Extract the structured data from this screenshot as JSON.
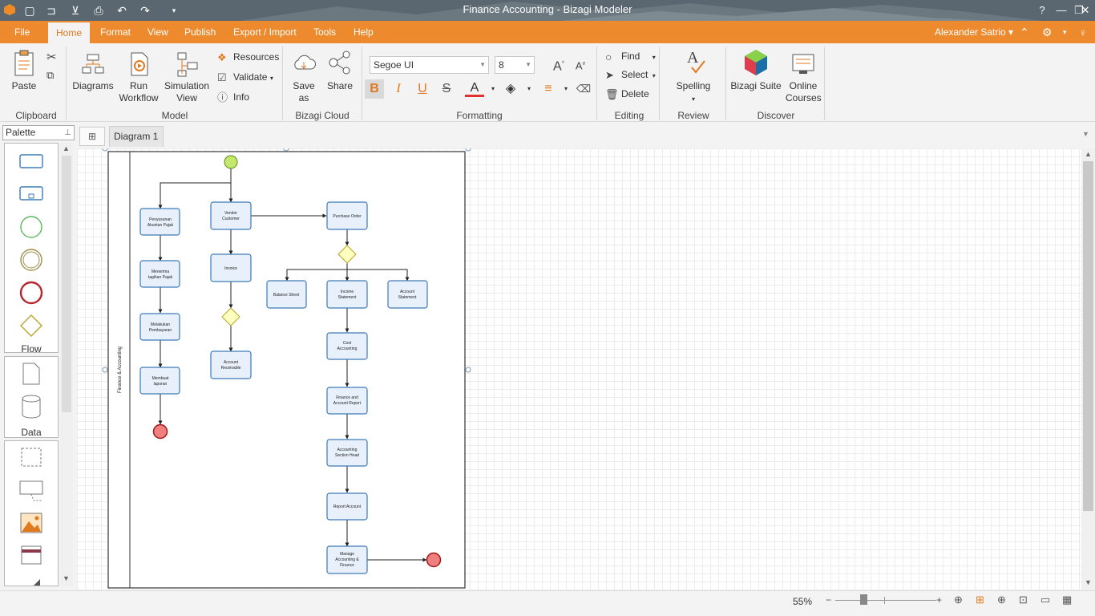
{
  "window": {
    "title": "Finance Accounting - Bizagi Modeler"
  },
  "menu": {
    "file": "File",
    "home": "Home",
    "format": "Format",
    "view": "View",
    "publish": "Publish",
    "export_import": "Export / Import",
    "tools": "Tools",
    "help": "Help",
    "user": "Alexander Satrio"
  },
  "ribbon": {
    "clipboard": {
      "paste": "Paste",
      "label": "Clipboard"
    },
    "model": {
      "diagrams": "Diagrams",
      "run_workflow_1": "Run",
      "run_workflow_2": "Workflow",
      "simulation_1": "Simulation",
      "simulation_2": "View",
      "resources": "Resources",
      "validate": "Validate",
      "info": "Info",
      "label": "Model"
    },
    "cloud": {
      "save_as": "Save as",
      "share": "Share",
      "label": "Bizagi Cloud"
    },
    "formatting": {
      "font": "Segoe UI",
      "size": "8",
      "label": "Formatting"
    },
    "editing": {
      "find": "Find",
      "select": "Select",
      "delete": "Delete",
      "label": "Editing"
    },
    "review": {
      "spelling": "Spelling",
      "label": "Review"
    },
    "discover": {
      "suite": "Bizagi Suite",
      "courses_1": "Online",
      "courses_2": "Courses",
      "label": "Discover"
    }
  },
  "palette": {
    "title": "Palette",
    "flow": "Flow",
    "data": "Data"
  },
  "tabs": {
    "diagram1": "Diagram 1"
  },
  "diagram": {
    "lane": "Finance & Accounting",
    "tasks": {
      "t1": [
        "Penyusunan",
        "Akuntan Pajak"
      ],
      "t2": [
        "Menerima",
        "tagihan Pajak"
      ],
      "t3": [
        "Melakukan",
        "Pembayaran"
      ],
      "t4": [
        "Membuat",
        "laporan"
      ],
      "t5": [
        "Vendor",
        "Customer"
      ],
      "t6": [
        "Invoice"
      ],
      "t7": [
        "Account",
        "Receivable"
      ],
      "t8": [
        "Purchase Order"
      ],
      "t9": [
        "Balance Sheet"
      ],
      "t10": [
        "Income",
        "Statement"
      ],
      "t11": [
        "Account",
        "Statement"
      ],
      "t12": [
        "Cost",
        "Accounting"
      ],
      "t13": [
        "Finance and",
        "Account Report"
      ],
      "t14": [
        "Accounting",
        "Section Head"
      ],
      "t15": [
        "Report Account"
      ],
      "t16": [
        "Manage",
        "Accounting &",
        "Finance"
      ]
    }
  },
  "status": {
    "zoom": "55%"
  },
  "colors": {
    "accent": "#ee8a2e",
    "task_border": "#3d7ab8",
    "task_fill": "#e8f1fb",
    "start": "#c4e86b",
    "end": "#f08080",
    "gateway": "#ffffc0"
  }
}
